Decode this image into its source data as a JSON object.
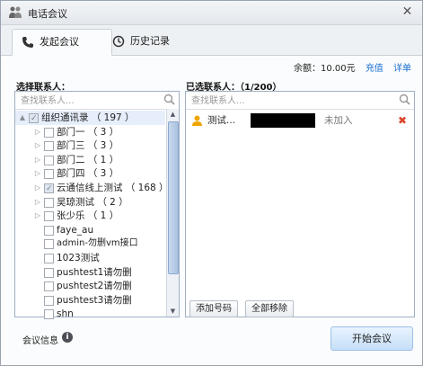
{
  "window": {
    "title": "电话会议"
  },
  "tabs": [
    {
      "label": "发起会议",
      "active": true
    },
    {
      "label": "历史记录",
      "active": false
    }
  ],
  "balance": {
    "text": "余额：10.00元",
    "recharge": "充值",
    "details": "详单"
  },
  "left_panel": {
    "title": "选择联系人：",
    "search_placeholder": "查找联系人...",
    "tree": [
      {
        "label": "组织通讯录 （ 197 ）",
        "expander": "▲",
        "checked": "partial",
        "level": 0
      },
      {
        "label": "部门一 （ 3 ）",
        "expander": "▷",
        "checked": "none",
        "level": 1
      },
      {
        "label": "部门三 （ 3 ）",
        "expander": "▷",
        "checked": "none",
        "level": 1
      },
      {
        "label": "部门二 （ 1 ）",
        "expander": "▷",
        "checked": "none",
        "level": 1
      },
      {
        "label": "部门四 （ 3 ）",
        "expander": "▷",
        "checked": "none",
        "level": 1
      },
      {
        "label": "云通信线上测试 （ 168 ）",
        "expander": "▷",
        "checked": "partial",
        "level": 1
      },
      {
        "label": "吴琼测试 （ 2 ）",
        "expander": "▷",
        "checked": "none",
        "level": 1
      },
      {
        "label": "张少乐 （ 1 ）",
        "expander": "▷",
        "checked": "none",
        "level": 1
      },
      {
        "label": "faye_au",
        "expander": "",
        "checked": "none",
        "level": 1
      },
      {
        "label": "admin-勿删vm接口",
        "expander": "",
        "checked": "none",
        "level": 1
      },
      {
        "label": "1023测试",
        "expander": "",
        "checked": "none",
        "level": 1
      },
      {
        "label": "pushtest1请勿删",
        "expander": "",
        "checked": "none",
        "level": 1
      },
      {
        "label": "pushtest2请勿删",
        "expander": "",
        "checked": "none",
        "level": 1
      },
      {
        "label": "pushtest3请勿删",
        "expander": "",
        "checked": "none",
        "level": 1
      },
      {
        "label": "shn",
        "expander": "",
        "checked": "none",
        "level": 1
      }
    ]
  },
  "right_panel": {
    "title": "已选联系人：（1/200）",
    "search_placeholder": "查找联系人...",
    "selected": [
      {
        "name": "测试...",
        "status": "未加入"
      }
    ],
    "add_number": "添加号码",
    "remove_all": "全部移除"
  },
  "footer": {
    "meeting_info": "会议信息",
    "info_glyph": "i",
    "start": "开始会议"
  },
  "colors": {
    "accent": "#1a6fd1",
    "remove_icon": "#d9452b",
    "person_icon": "#f0a500"
  }
}
